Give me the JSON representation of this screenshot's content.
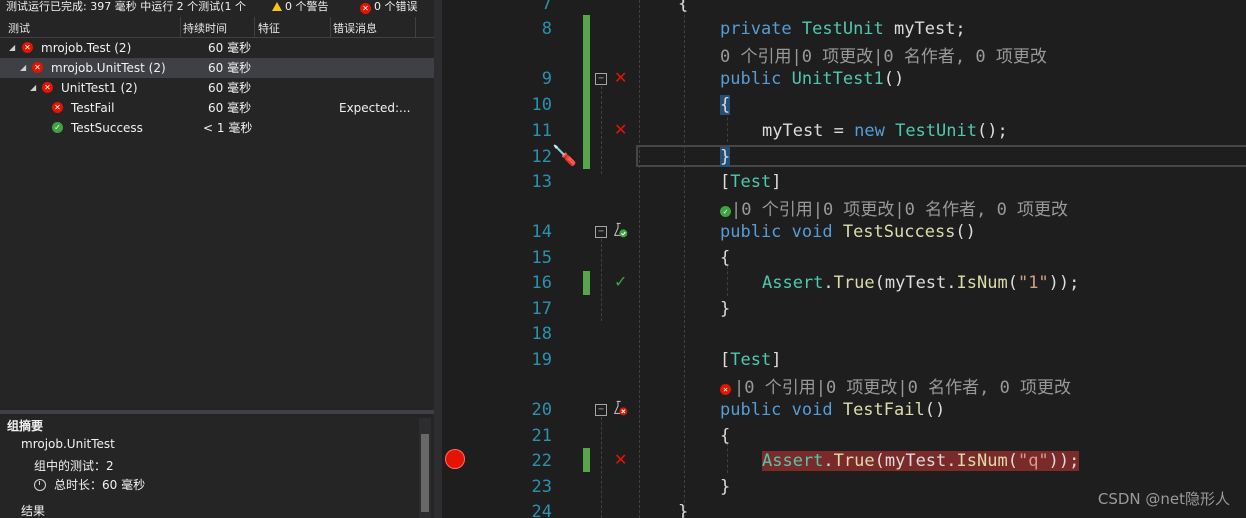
{
  "explorer": {
    "status": {
      "completed": "测试运行已完成: 397 毫秒 中运行 2 个测试(1 个",
      "warnings": "0 个警告",
      "errors": "0 个错误"
    },
    "columns": [
      "测试",
      "持续时间",
      "特征",
      "错误消息"
    ],
    "tree": [
      {
        "name": "mrojob.Test (2)",
        "duration": "60 毫秒",
        "message": "",
        "status": "failed",
        "level": 0,
        "expanded": true
      },
      {
        "name": "mrojob.UnitTest (2)",
        "duration": "60 毫秒",
        "message": "",
        "status": "failed",
        "level": 1,
        "expanded": true
      },
      {
        "name": "UnitTest1 (2)",
        "duration": "60 毫秒",
        "message": "",
        "status": "failed",
        "level": 2,
        "expanded": true
      },
      {
        "name": "TestFail",
        "duration": "60 毫秒",
        "message": "Expected:...",
        "status": "failed",
        "level": 3
      },
      {
        "name": "TestSuccess",
        "duration": "< 1 毫秒",
        "message": "",
        "status": "passed",
        "level": 3
      }
    ],
    "summary": {
      "title": "组摘要",
      "group": "mrojob.UnitTest",
      "count": "组中的测试：2",
      "total": "总时长：60 毫秒",
      "result": "结果"
    }
  },
  "editor": {
    "lines": [
      {
        "num": "7"
      },
      {
        "num": "8"
      },
      {
        "num": "9"
      },
      {
        "num": "10"
      },
      {
        "num": "11"
      },
      {
        "num": "12"
      },
      {
        "num": "13"
      },
      {
        "num": "14"
      },
      {
        "num": "15"
      },
      {
        "num": "16"
      },
      {
        "num": "17"
      },
      {
        "num": "18"
      },
      {
        "num": "19"
      },
      {
        "num": "20"
      },
      {
        "num": "21"
      },
      {
        "num": "22"
      },
      {
        "num": "23"
      },
      {
        "num": "24"
      }
    ],
    "code": {
      "l7": "{",
      "l8_kw": "private ",
      "l8_ty": "TestUnit",
      "l8_rest": " myTest;",
      "lens1": "0 个引用|0 项更改|0 名作者, 0 项更改",
      "l9_kw": "public ",
      "l9_fn": "UnitTest1",
      "l9_rest": "()",
      "l10": "{",
      "l11_a": "myTest = ",
      "l11_kw": "new ",
      "l11_ty": "TestUnit",
      "l11_rest": "();",
      "l12": "}",
      "l13_a": "[",
      "l13_ty": "Test",
      "l13_b": "]",
      "lens2": "|0 个引用|0 项更改|0 名作者, 0 项更改",
      "l14_kw": "public void ",
      "l14_fn": "TestSuccess",
      "l14_rest": "()",
      "l15": "{",
      "l16_ty": "Assert",
      "l16_a": ".",
      "l16_fn": "True",
      "l16_b": "(myTest.",
      "l16_fn2": "IsNum",
      "l16_c": "(",
      "l16_st": "\"1\"",
      "l16_d": "));",
      "l17": "}",
      "l19_a": "[",
      "l19_ty": "Test",
      "l19_b": "]",
      "lens3": "|0 个引用|0 项更改|0 名作者, 0 项更改",
      "l20_kw": "public void ",
      "l20_fn": "TestFail",
      "l20_rest": "()",
      "l21": "{",
      "l22_ty": "Assert",
      "l22_a": ".",
      "l22_fn": "True",
      "l22_b": "(myTest.",
      "l22_fn2": "IsNum",
      "l22_c": "(",
      "l22_st": "\"q\"",
      "l22_d": "));",
      "l23": "}",
      "l24": "}"
    },
    "watermark": "CSDN @net隐形人"
  },
  "colors": {
    "keyword": "#569cd6",
    "type": "#4ec9b0",
    "method": "#dcdcaa",
    "string": "#d69d85",
    "line_number": "#2b91af",
    "failed": "#e51400",
    "passed": "#3fa33f"
  }
}
